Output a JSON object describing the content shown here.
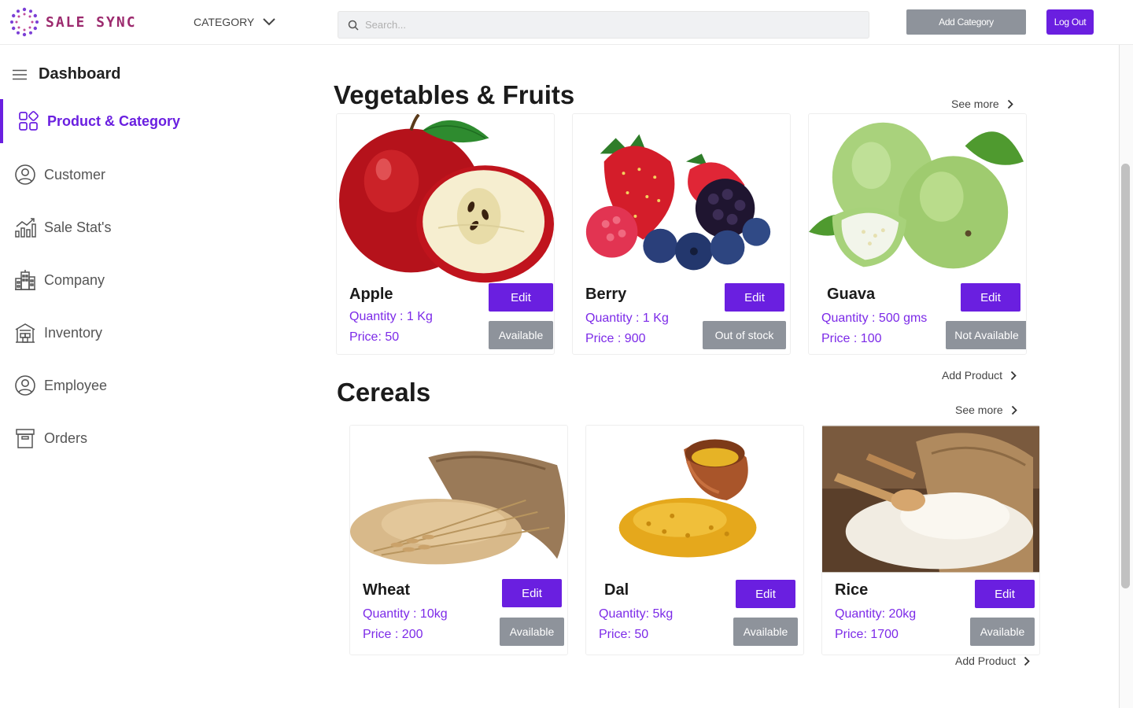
{
  "header": {
    "brand": "SALE SYNC",
    "category_label": "CATEGORY",
    "search_placeholder": "Search...",
    "add_category_label": "Add Category",
    "logout_label": "Log Out"
  },
  "sidebar": {
    "title": "Dashboard",
    "items": [
      {
        "label": "Product & Category",
        "icon": "grid-icon",
        "active": true
      },
      {
        "label": "Customer",
        "icon": "user-circle-icon"
      },
      {
        "label": "Sale Stat's",
        "icon": "bar-chart-icon"
      },
      {
        "label": "Company",
        "icon": "building-icon"
      },
      {
        "label": "Inventory",
        "icon": "warehouse-icon"
      },
      {
        "label": "Employee",
        "icon": "user-circle-icon"
      },
      {
        "label": "Orders",
        "icon": "archive-box-icon"
      }
    ]
  },
  "sections": [
    {
      "title": "Vegetables & Fruits",
      "see_more": "See more",
      "add_product": "Add Product",
      "products": [
        {
          "name": "Apple",
          "quantity": "Quantity : 1 Kg",
          "price": "Price: 50",
          "edit": "Edit",
          "status": "Available",
          "image": "apple-image"
        },
        {
          "name": "Berry",
          "quantity": "Quantity : 1 Kg",
          "price": "Price : 900",
          "edit": "Edit",
          "status": "Out  of stock",
          "image": "berry-image"
        },
        {
          "name": "Guava",
          "quantity": "Quantity : 500 gms",
          "price": "Price : 100",
          "edit": "Edit",
          "status": "Not Available",
          "image": "guava-image"
        }
      ]
    },
    {
      "title": "Cereals",
      "see_more": "See more",
      "add_product": "Add Product",
      "products": [
        {
          "name": "Wheat",
          "quantity": "Quantity : 10kg",
          "price": "Price :  200",
          "edit": "Edit",
          "status": "Available",
          "image": "wheat-image"
        },
        {
          "name": "Dal",
          "quantity": "Quantity: 5kg",
          "price": "Price: 50",
          "edit": "Edit",
          "status": "Available",
          "image": "dal-image"
        },
        {
          "name": "Rice",
          "quantity": "Quantity: 20kg",
          "price": "Price: 1700",
          "edit": "Edit",
          "status": "Available",
          "image": "rice-image"
        }
      ]
    }
  ],
  "colors": {
    "accent": "#6a1fe0",
    "accent_text": "#7c2ae8",
    "muted_button": "#8e939b",
    "brand": "#9c2a6e"
  }
}
